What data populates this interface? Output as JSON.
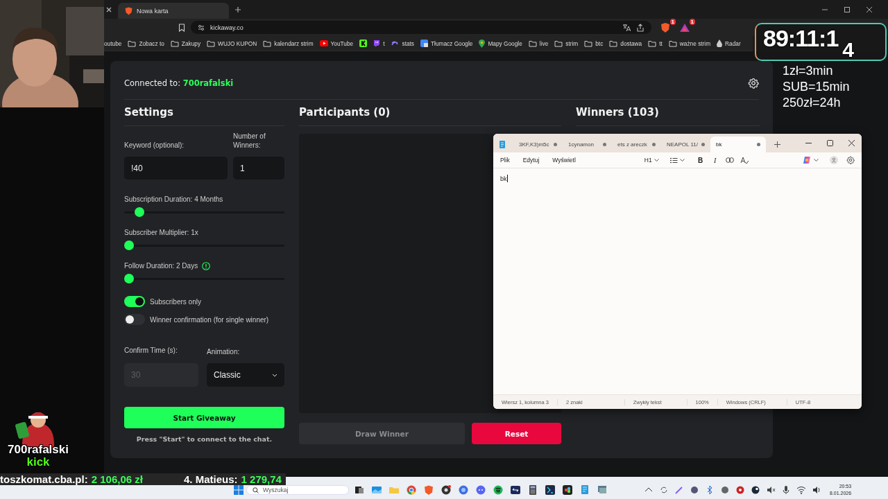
{
  "browser": {
    "tabs": [
      {
        "label": "Nowa karta",
        "selected": true
      }
    ],
    "address": "kickaway.co",
    "extensions": [
      {
        "kind": "shield",
        "badge": "1"
      },
      {
        "kind": "rewards",
        "badge": "1"
      }
    ],
    "bookmarks": [
      {
        "kind": "plain",
        "label": "outube"
      },
      {
        "kind": "folder",
        "label": "Zobacz to"
      },
      {
        "kind": "folder",
        "label": "Zakupy"
      },
      {
        "kind": "folder",
        "label": "WUJO KUPON"
      },
      {
        "kind": "folder",
        "label": "kalendarz strim"
      },
      {
        "kind": "youtube",
        "label": "YouTube"
      },
      {
        "kind": "kick"
      },
      {
        "kind": "twitch",
        "label": "t"
      },
      {
        "kind": "stats",
        "label": "stats"
      },
      {
        "kind": "translate",
        "label": "Tłumacz Google"
      },
      {
        "kind": "maps",
        "label": "Mapy Google"
      },
      {
        "kind": "folder",
        "label": "live"
      },
      {
        "kind": "folder",
        "label": "strim"
      },
      {
        "kind": "folder",
        "label": "btc"
      },
      {
        "kind": "folder",
        "label": "dostawa"
      },
      {
        "kind": "folder",
        "label": "tt"
      },
      {
        "kind": "folder",
        "label": "ważne strim"
      },
      {
        "kind": "drop",
        "label": "Radar"
      }
    ]
  },
  "giveaway": {
    "connected": "Connected to: **700rafalski**",
    "settings": {
      "title": "Settings",
      "keyword": {
        "label": "Keyword (optional):",
        "value": "!40"
      },
      "winners": {
        "label": "Number of Winners:",
        "value": "1"
      },
      "sliders": [
        {
          "label": "Subscription Duration: 4 Months",
          "level": 0.07,
          "info": false
        },
        {
          "label": "Subscriber Multiplier: 1x",
          "level": 0,
          "info": false
        },
        {
          "label": "Follow Duration: 2 Days",
          "level": 0,
          "info": true
        }
      ],
      "toggles": [
        {
          "label": "Subscribers only",
          "on": true
        },
        {
          "label": "Winner confirmation (for single winner)",
          "on": false
        }
      ],
      "confirm_time": {
        "label": "Confirm Time (s):",
        "value": "30",
        "disabled": true
      },
      "animation": {
        "label": "Animation:",
        "value": "Classic"
      },
      "start_button": "Start Giveaway",
      "hint": "Press \"Start\" to connect to the chat."
    },
    "participants": {
      "title": "Participants (0)",
      "draw_button": {
        "label": "Draw Winner",
        "disabled": true
      },
      "reset_button": "Reset"
    },
    "winners": {
      "title": "Winners (103)"
    }
  },
  "notepad": {
    "tabs": [
      {
        "label": "3KF,K3)m5c",
        "selected": false,
        "unsaved": true
      },
      {
        "label": "1cynamon",
        "selected": false,
        "unsaved": true
      },
      {
        "label": "ets z areczk",
        "selected": false,
        "unsaved": true
      },
      {
        "label": "NEAPOL 11/",
        "selected": false,
        "unsaved": true
      },
      {
        "label": "bk",
        "selected": true,
        "unsaved": true
      }
    ],
    "menu": [
      "Plik",
      "Edytuj",
      "Wyświetl"
    ],
    "heading": "H1",
    "format_buttons": [
      "B",
      "I"
    ],
    "content": "bk",
    "status": [
      "Wiersz 1, kolumna 3",
      "2 znaki",
      "Zwykły tekst",
      "100%",
      "Windows (CRLF)",
      "UTF-8"
    ]
  },
  "stream": {
    "timer": {
      "main": "89:11:1",
      "tail": "4"
    },
    "rates": [
      "1zł=3min",
      "SUB=15min",
      "250zł=24h"
    ],
    "logo": {
      "name": "700rafalski",
      "platform": "kick"
    },
    "ticker": [
      {
        "name": "toszkomat.cba.pl:",
        "amount": "2 106,06 zł"
      },
      {
        "name": "4. Matieus:",
        "amount": "1 279,74"
      }
    ]
  },
  "taskbar": {
    "search": {
      "placeholder": "Wyszukaj"
    },
    "time": "20:53",
    "date": "8.01.2026"
  }
}
